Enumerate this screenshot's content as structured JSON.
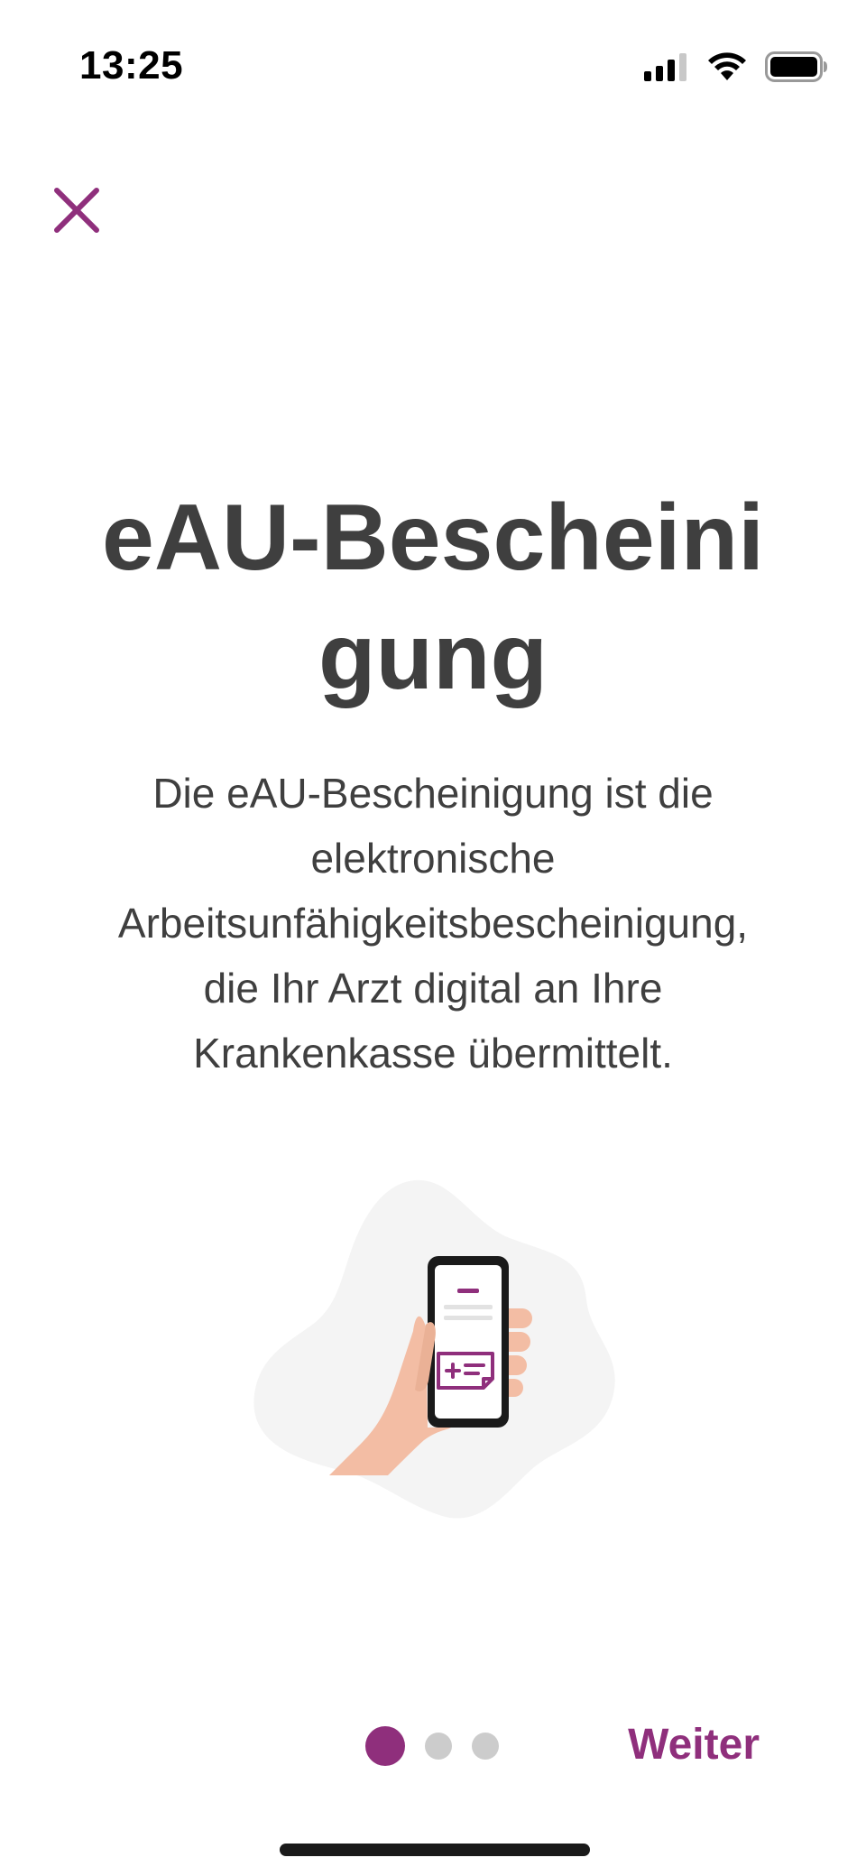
{
  "status_bar": {
    "time": "13:25",
    "icons": [
      "cellular-signal-icon",
      "wifi-icon",
      "battery-icon"
    ]
  },
  "toolbar": {
    "close_icon": "close-icon"
  },
  "onboarding": {
    "title_line1": "eAU-Bescheini",
    "title_line2": "gung",
    "description_lines": [
      "Die eAU-Bescheinigung ist die",
      "elektronische",
      "Arbeitsunfähigkeitsbescheinigung,",
      "die Ihr Arzt digital an Ihre",
      "Krankenkasse übermittelt."
    ],
    "illustration_icon": "hand-holding-phone-icon"
  },
  "pager": {
    "total_pages": 3,
    "current_page": 1
  },
  "next_label": "Weiter",
  "colors": {
    "accent": "#8f2f7c",
    "text": "#3f3f3f",
    "dot_inactive": "#cccccc"
  }
}
